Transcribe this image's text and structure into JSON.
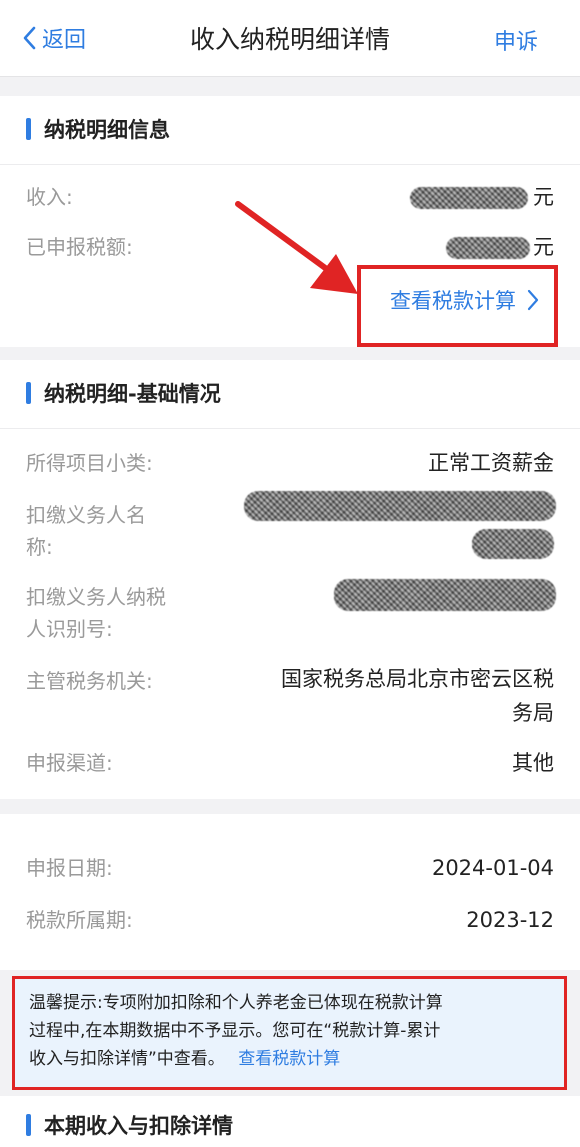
{
  "nav": {
    "back_label": "返回",
    "title": "收入纳税明细详情",
    "appeal_label": "申诉"
  },
  "tax_info": {
    "section_title": "纳税明细信息",
    "income_label": "收入:",
    "income_unit": "元",
    "declared_tax_label": "已申报税额:",
    "declared_tax_unit": "元",
    "view_calc_link": "查看税款计算"
  },
  "basic": {
    "section_title": "纳税明细-基础情况",
    "rows": [
      {
        "label": "所得项目小类:",
        "value": "正常工资薪金"
      },
      {
        "label_line1": "扣缴义务人名",
        "label_line2": "称:"
      },
      {
        "label_line1": "扣缴义务人纳税",
        "label_line2": "人识别号:"
      },
      {
        "label": "主管税务机关:",
        "value_line1": "国家税务总局北京市密云区税",
        "value_line2": "务局"
      },
      {
        "label": "申报渠道:",
        "value": "其他"
      }
    ]
  },
  "dates": {
    "declare_date_label": "申报日期:",
    "declare_date_value": "2024-01-04",
    "period_label": "税款所属期:",
    "period_value": "2023-12"
  },
  "notice": {
    "line1": "温馨提示:专项附加扣除和个人养老金已体现在税款计算",
    "line2": "过程中,在本期数据中不予显示。您可在“税款计算-累计",
    "line3_text": "收入与扣除详情”中查看。",
    "line3_link": "查看税款计算"
  },
  "bottom_section": {
    "section_title": "本期收入与扣除详情"
  },
  "colors": {
    "accent": "#2f7de1",
    "highlight_red": "#e02424",
    "notice_bg": "#eaf3fd"
  }
}
